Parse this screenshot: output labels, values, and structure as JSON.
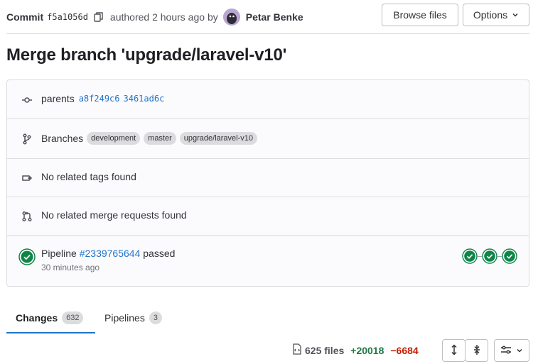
{
  "header": {
    "commit_label": "Commit",
    "sha": "f5a1056d",
    "authored_prefix": "authored",
    "authored_time": "2 hours ago",
    "authored_by": "by",
    "author_name": "Petar Benke",
    "browse_files_label": "Browse files",
    "options_label": "Options"
  },
  "title": "Merge branch 'upgrade/laravel-v10'",
  "info": {
    "parents_label": "parents",
    "parents": [
      "a8f249c6",
      "3461ad6c"
    ],
    "branches_label": "Branches",
    "branches": [
      "development",
      "master",
      "upgrade/laravel-v10"
    ],
    "tags_text": "No related tags found",
    "mr_text": "No related merge requests found",
    "pipeline": {
      "label": "Pipeline",
      "id": "#2339765644",
      "status_text": "passed",
      "time": "30 minutes ago",
      "status_color": "#108548"
    }
  },
  "tabs": [
    {
      "label": "Changes",
      "count": "632"
    },
    {
      "label": "Pipelines",
      "count": "3"
    }
  ],
  "diff": {
    "files": "625 files",
    "additions": "+20018",
    "deletions": "−6684"
  },
  "icons": {
    "copy": "copy-icon",
    "commit": "commit-icon",
    "branch": "branch-icon",
    "tag": "tag-icon",
    "merge_request": "merge-request-icon",
    "pipeline_status": "status-success-icon",
    "file": "doc-code-icon",
    "expand": "expand-icon",
    "collapse": "collapse-icon",
    "preferences": "preferences-icon"
  },
  "colors": {
    "link": "#1f75cb",
    "success": "#108548",
    "additions": "#217645",
    "deletions": "#c91c00"
  }
}
